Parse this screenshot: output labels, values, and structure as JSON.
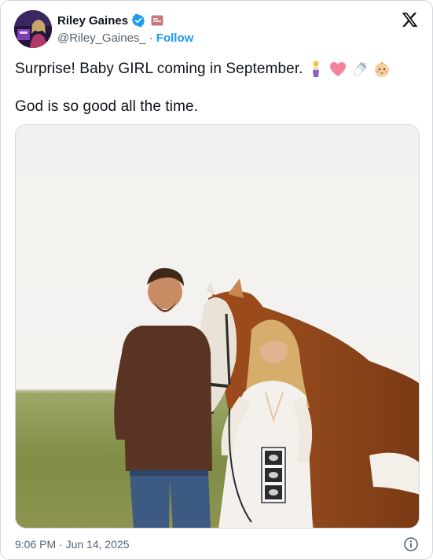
{
  "post": {
    "author_name": "Riley Gaines",
    "handle": "@Riley_Gaines_",
    "separator": "·",
    "follow_label": "Follow",
    "text_line1": "Surprise! Baby GIRL coming in September.",
    "text_line2": "God is so good all the time.",
    "emojis": [
      "baby-bottle-girl-emoji",
      "pink-heart-emoji",
      "baby-bottle-emoji",
      "baby-face-emoji"
    ],
    "timestamp": "9:06 PM · Jun 14, 2025"
  },
  "icons": {
    "verified": "verified-badge-icon",
    "affiliate": "affiliate-badge-icon",
    "x_logo": "x-logo-icon",
    "info": "info-icon"
  },
  "colors": {
    "text": "#0f1419",
    "secondary": "#536471",
    "accent": "#1d9bf0",
    "border": "#cfd9de"
  }
}
